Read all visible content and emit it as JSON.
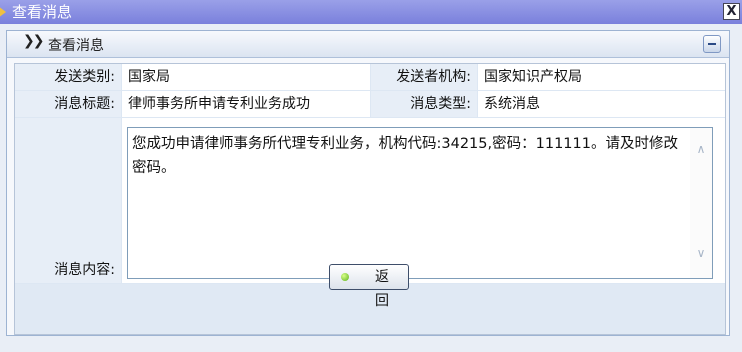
{
  "window": {
    "title": "查看消息",
    "close_glyph": "X"
  },
  "panel": {
    "title": "查看消息",
    "header_icon": "double-chevron-right-icon"
  },
  "fields": {
    "send_category_label": "发送类别:",
    "send_category_value": "国家局",
    "sender_org_label": "发送者机构:",
    "sender_org_value": "国家知识产权局",
    "message_title_label": "消息标题:",
    "message_title_value": "律师事务所申请专利业务成功",
    "message_type_label": "消息类型:",
    "message_type_value": "系统消息",
    "message_content_label": "消息内容:",
    "message_content_value": "您成功申请律师事务所代理专利业务，机构代码:34215,密码：111111。请及时修改密码。"
  },
  "actions": {
    "back_label": "返 回"
  },
  "colors": {
    "titlebar": "#8a90e2",
    "panel_border": "#9db3d2",
    "label_bg": "#e7eef7"
  }
}
